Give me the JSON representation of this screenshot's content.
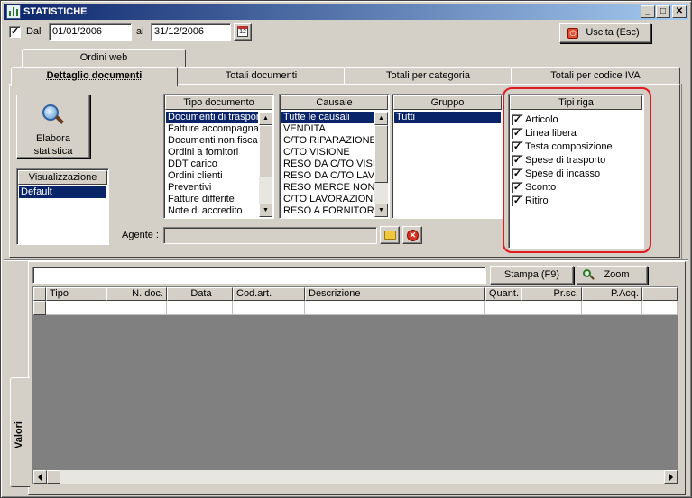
{
  "window": {
    "title": "STATISTICHE"
  },
  "dates": {
    "from_label": "Dal",
    "from_value": "01/01/2006",
    "to_label": "al",
    "to_value": "31/12/2006",
    "from_checked": true
  },
  "exit_button": {
    "label": "Uscita (Esc)"
  },
  "tabs_back": [
    "Ordini web"
  ],
  "tabs_front": [
    "Dettaglio documenti",
    "Totali documenti",
    "Totali per categoria",
    "Totali per codice IVA"
  ],
  "elabora": {
    "label_line1": "Elabora",
    "label_line2": "statistica"
  },
  "visualizzazione": {
    "header": "Visualizzazione",
    "items": [
      "Default"
    ],
    "selected": 0
  },
  "tipo_documento": {
    "header": "Tipo documento",
    "items": [
      "Documenti di trasporto",
      "Fatture accompagnatorie",
      "Documenti non fiscali",
      "Ordini a fornitori",
      "DDT carico",
      "Ordini clienti",
      "Preventivi",
      "Fatture differite",
      "Note di accredito"
    ],
    "selected": 0
  },
  "causale": {
    "header": "Causale",
    "items": [
      "Tutte le causali",
      "VENDITA",
      "C/TO RIPARAZIONE",
      "C/TO VISIONE",
      "RESO DA C/TO VISIONE",
      "RESO DA C/TO LAVORAZIONE",
      "RESO MERCE NON CONFORME",
      "C/TO LAVORAZIONE",
      "RESO A FORNITORE"
    ],
    "selected": 0
  },
  "gruppo": {
    "header": "Gruppo",
    "items": [
      "Tutti"
    ],
    "selected": 0
  },
  "tipi_riga": {
    "header": "Tipi riga",
    "items": [
      {
        "label": "Articolo",
        "checked": true
      },
      {
        "label": "Linea libera",
        "checked": true
      },
      {
        "label": "Testa composizione",
        "checked": true
      },
      {
        "label": "Spese di trasporto",
        "checked": true
      },
      {
        "label": "Spese di incasso",
        "checked": true
      },
      {
        "label": "Sconto",
        "checked": true
      },
      {
        "label": "Ritiro",
        "checked": true
      }
    ],
    "highlight_color": "#e0191e"
  },
  "agente": {
    "label": "Agente :",
    "value": ""
  },
  "toolbar": {
    "search_value": "",
    "stampa_label": "Stampa (F9)",
    "zoom_label": "Zoom"
  },
  "grid": {
    "columns": [
      "Tipo",
      "N. doc.",
      "Data",
      "Cod.art.",
      "Descrizione",
      "Quant.",
      "Pr.sc.",
      "P.Acq."
    ]
  },
  "side_tab": {
    "label": "Valori"
  }
}
